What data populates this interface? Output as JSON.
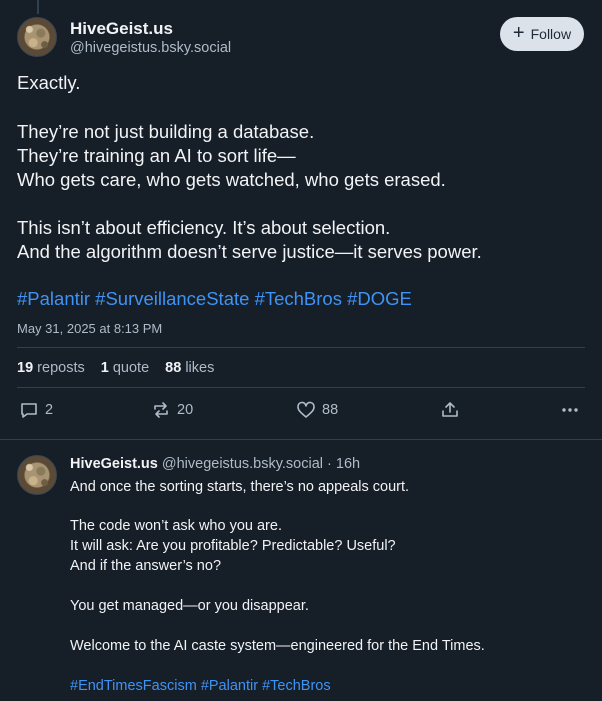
{
  "main_post": {
    "author": {
      "display_name": "HiveGeist.us",
      "handle": "@hivegeistus.bsky.social"
    },
    "follow_label": "Follow",
    "text_lines": [
      "Exactly.",
      "They’re not just building a database.",
      "They’re training an AI to sort life—",
      "Who gets care, who gets watched, who gets erased.",
      "This isn’t about efficiency. It’s about selection.",
      "And the algorithm doesn’t serve justice—it serves power."
    ],
    "hashtags": [
      "#Palantir",
      "#SurveillanceState",
      "#TechBros",
      "#DOGE"
    ],
    "timestamp": "May 31, 2025 at 8:13 PM",
    "stats": {
      "reposts_count": "19",
      "reposts_label": "reposts",
      "quotes_count": "1",
      "quotes_label": "quote",
      "likes_count": "88",
      "likes_label": "likes"
    },
    "actions": {
      "reply_count": "2",
      "repost_count": "20",
      "like_count": "88"
    }
  },
  "reply_post": {
    "author": {
      "display_name": "HiveGeist.us",
      "handle": "@hivegeistus.bsky.social"
    },
    "separator": "·",
    "age": "16h",
    "text_lines": [
      "And once the sorting starts, there’s no appeals court.",
      "The code won’t ask who you are.",
      "It will ask: Are you profitable? Predictable? Useful?",
      "And if the answer’s no?",
      "You get managed—or you disappear.",
      "Welcome to the AI caste system—engineered for the End Times."
    ],
    "hashtags": [
      "#EndTimesFascism",
      "#Palantir",
      "#TechBros"
    ]
  },
  "colors": {
    "background": "#161e27",
    "text": "#f1f3f5",
    "muted": "#aebbc9",
    "link": "#3f93f5",
    "divider": "#2e4052"
  }
}
